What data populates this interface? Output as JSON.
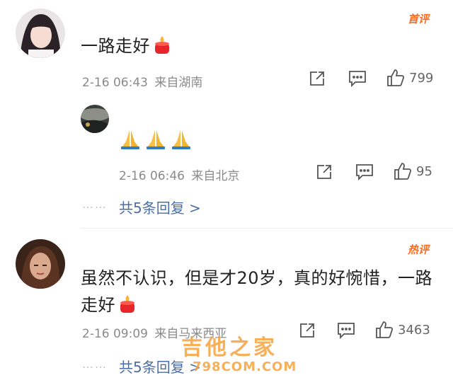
{
  "comments": [
    {
      "badge": "首评",
      "text": "一路走好",
      "time": "2-16 06:43",
      "location": "来自湖南",
      "likes": "799",
      "reply": {
        "emojis": [
          "🙏",
          "🙏",
          "🙏"
        ],
        "time": "2-16 06:46",
        "location": "来自北京",
        "likes": "95"
      },
      "more_replies": "共5条回复 >"
    },
    {
      "badge": "热评",
      "text": "虽然不认识，但是才20岁，真的好惋惜，一路走好",
      "time": "2-16 09:09",
      "location": "来自马来西亚",
      "likes": "3463",
      "more_replies": "共5条回复 >"
    }
  ],
  "dots": "……",
  "watermark": {
    "name": "吉他之家",
    "url": "798COM.COM"
  },
  "icons": [
    "share-icon",
    "comment-icon",
    "like-icon",
    "candle-icon",
    "pray-emoji"
  ],
  "colors": {
    "badge": "#ff6a1f",
    "link": "#4b6ea6",
    "meta": "#8a8a8a"
  }
}
